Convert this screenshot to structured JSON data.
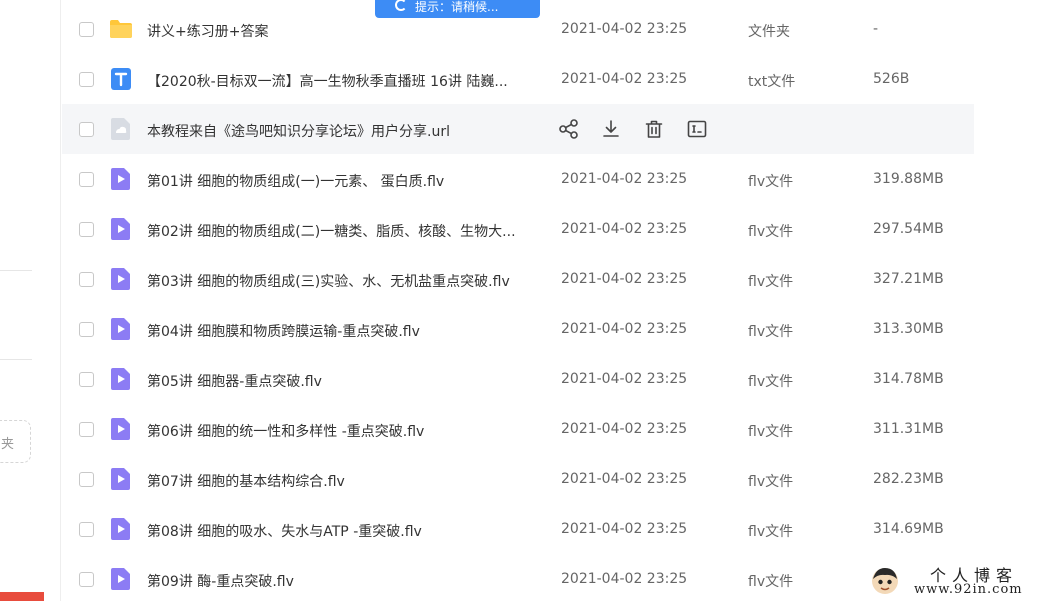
{
  "toast": {
    "text": "提示：请稍候..."
  },
  "sidebar": {
    "new_folder_label": "夹"
  },
  "files": [
    {
      "icon": "folder-icon",
      "name": "讲义+练习册+答案",
      "date": "2021-04-02 23:25",
      "type": "文件夹",
      "size": "-"
    },
    {
      "icon": "txt-file-icon",
      "name": "【2020秋-目标双一流】高一生物秋季直播班 16讲 陆巍...",
      "date": "2021-04-02 23:25",
      "type": "txt文件",
      "size": "526B"
    },
    {
      "icon": "url-file-icon",
      "name": "本教程来自《途鸟吧知识分享论坛》用户分享.url",
      "date": "",
      "type": "",
      "size": "",
      "hover": true
    },
    {
      "icon": "video-file-icon",
      "name": "第01讲 细胞的物质组成(一)一元素、 蛋白质.flv",
      "date": "2021-04-02 23:25",
      "type": "flv文件",
      "size": "319.88MB"
    },
    {
      "icon": "video-file-icon",
      "name": "第02讲 细胞的物质组成(二)一糖类、脂质、核酸、生物大...",
      "date": "2021-04-02 23:25",
      "type": "flv文件",
      "size": "297.54MB"
    },
    {
      "icon": "video-file-icon",
      "name": "第03讲 细胞的物质组成(三)实验、水、无机盐重点突破.flv",
      "date": "2021-04-02 23:25",
      "type": "flv文件",
      "size": "327.21MB"
    },
    {
      "icon": "video-file-icon",
      "name": "第04讲 细胞膜和物质跨膜运输-重点突破.flv",
      "date": "2021-04-02 23:25",
      "type": "flv文件",
      "size": "313.30MB"
    },
    {
      "icon": "video-file-icon",
      "name": "第05讲 细胞器-重点突破.flv",
      "date": "2021-04-02 23:25",
      "type": "flv文件",
      "size": "314.78MB"
    },
    {
      "icon": "video-file-icon",
      "name": "第06讲 细胞的统一性和多样性 -重点突破.flv",
      "date": "2021-04-02 23:25",
      "type": "flv文件",
      "size": "311.31MB"
    },
    {
      "icon": "video-file-icon",
      "name": "第07讲 细胞的基本结构综合.flv",
      "date": "2021-04-02 23:25",
      "type": "flv文件",
      "size": "282.23MB"
    },
    {
      "icon": "video-file-icon",
      "name": "第08讲 细胞的吸水、失水与ATP -重突破.flv",
      "date": "2021-04-02 23:25",
      "type": "flv文件",
      "size": "314.69MB"
    },
    {
      "icon": "video-file-icon",
      "name": "第09讲 酶-重点突破.flv",
      "date": "2021-04-02 23:25",
      "type": "flv文件",
      "size": ""
    }
  ],
  "row_actions": [
    "share-icon",
    "download-icon",
    "delete-icon",
    "rename-icon"
  ],
  "watermark": {
    "title": "个人博客",
    "url": "www.92in.com"
  },
  "colors": {
    "folder": "#ffc73a",
    "txt": "#3d8cf5",
    "video": "#8c7cf4",
    "url": "#d8dce3",
    "hover_row": "#f5f6f8",
    "toast": "#3d8cf5"
  }
}
